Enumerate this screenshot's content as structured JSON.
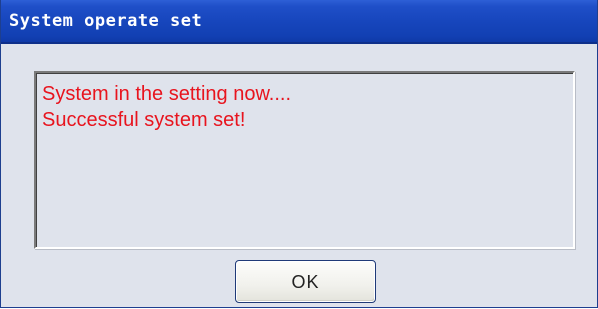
{
  "window": {
    "title": "System operate set"
  },
  "message": {
    "lines": [
      "System in the setting now....",
      "Successful system set!"
    ],
    "text_color": "#e8141e"
  },
  "buttons": {
    "ok_label": "OK"
  },
  "colors": {
    "titlebar": "#1746bd",
    "dialog_background": "#dfe3ec"
  }
}
